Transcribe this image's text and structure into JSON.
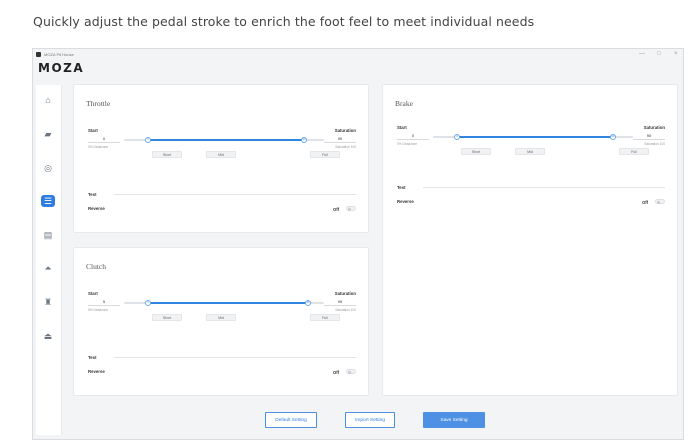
{
  "caption": "Quickly adjust the pedal stroke to enrich the foot feel to meet individual needs",
  "window": {
    "title": "MOZA Pit House",
    "logo": "MOZA",
    "controls": {
      "minimize": "—",
      "maximize": "□",
      "close": "×"
    }
  },
  "sidebar": {
    "items": [
      {
        "icon": "home-icon",
        "glyph": "⌂",
        "active": false
      },
      {
        "icon": "steering-wheel-icon",
        "glyph": "▰",
        "active": false
      },
      {
        "icon": "shield-icon",
        "glyph": "◎",
        "active": false
      },
      {
        "icon": "pedals-icon",
        "glyph": "☰",
        "active": true
      },
      {
        "icon": "shifter-icon",
        "glyph": "▤",
        "active": false
      },
      {
        "icon": "dashboard-icon",
        "glyph": "⏶",
        "active": false
      },
      {
        "icon": "handbrake-icon",
        "glyph": "♜",
        "active": false
      },
      {
        "icon": "device-icon",
        "glyph": "⏏",
        "active": false
      }
    ]
  },
  "throttle": {
    "title": "Throttle",
    "start_label": "Start",
    "saturation_label": "Saturation",
    "start_value": "0",
    "saturation_value": "90",
    "start_hint": "0% Deadzone",
    "saturation_hint": "Saturation 100",
    "knob_start": "0",
    "knob_end": "90",
    "fill_from": 0.12,
    "fill_to": 0.9,
    "buttons": [
      "Short",
      "Mid",
      "Full"
    ],
    "test_label": "Test",
    "reverse_label": "Reverse",
    "reverse_state": "Off"
  },
  "clutch": {
    "title": "Clutch",
    "start_label": "Start",
    "saturation_label": "Saturation",
    "start_value": "5",
    "saturation_value": "95",
    "start_hint": "5% Deadzone",
    "saturation_hint": "Saturation 100",
    "knob_start": "5",
    "knob_end": "95",
    "fill_from": 0.12,
    "fill_to": 0.92,
    "buttons": [
      "Short",
      "Mid",
      "Full"
    ],
    "test_label": "Test",
    "reverse_label": "Reverse",
    "reverse_state": "Off"
  },
  "brake": {
    "title": "Brake",
    "start_label": "Start",
    "saturation_label": "Saturation",
    "start_value": "0",
    "saturation_value": "90",
    "start_hint": "0% Deadzone",
    "saturation_hint": "Saturation 100",
    "knob_start": "0",
    "knob_end": "90",
    "fill_from": 0.12,
    "fill_to": 0.9,
    "buttons": [
      "Short",
      "Mid",
      "Full"
    ],
    "test_label": "Test",
    "reverse_label": "Reverse",
    "reverse_state": "Off"
  },
  "footer": {
    "default_setting": "Default Setting",
    "import_setting": "Import Setting",
    "save_setting": "Save Setting"
  },
  "colors": {
    "accent": "#2f7de1",
    "slider_fill": "#2f86de",
    "window_bg": "#f3f4f6"
  }
}
